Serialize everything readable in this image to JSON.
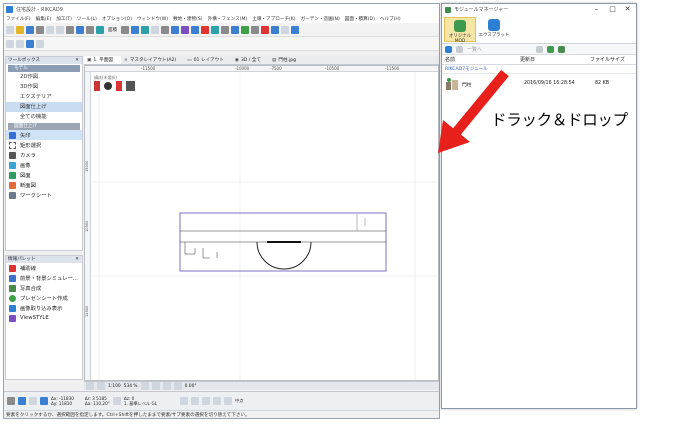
{
  "main_window": {
    "title": "住宅設計 - RIKCAD9",
    "menu": [
      "ファイル(F)",
      "編集(E)",
      "加工(T)",
      "ツール(L)",
      "オプション(O)",
      "ウィンドウ(W)",
      "敷地・建物(S)",
      "外構・フェンス(M)",
      "土壌・アプローチ(K)",
      "ガーデン・造園(N)",
      "図面・積算(D)",
      "ヘルプ(H)"
    ],
    "toolbar_label": "面積"
  },
  "tool_box": {
    "title": "ツールボックス",
    "group_top": "モデル",
    "tree_items": [
      "2D作図",
      "3D作図",
      "エクステリア",
      "図面仕上げ",
      "全ての機能"
    ],
    "selected_tree_item": "図面仕上げ",
    "group_bottom": "図面仕上げ",
    "tools": [
      "矢印",
      "矩形選択",
      "カメラ",
      "画像",
      "図面",
      "断面図",
      "ワークシート"
    ]
  },
  "model_palette": {
    "title": "情報パレット",
    "items": [
      "補助線",
      "前景・背景シミュレー...",
      "写真合成",
      "プレゼンシート作成",
      "画像取り込み表示",
      "ViewSTYLE"
    ]
  },
  "doc_tabs": [
    {
      "glyph": "▣",
      "label": "1. 平面図"
    },
    {
      "glyph": "×",
      "label": "マスタレイアウト(A2)"
    },
    {
      "glyph": "▭",
      "label": "01 レイアウト"
    },
    {
      "glyph": "◉",
      "label": "3D / 全て"
    },
    {
      "glyph": "▤",
      "label": "門柱.jpg"
    }
  ],
  "canvas": {
    "ruler_top": [
      "-11500",
      "-10000",
      "-7500",
      "-10500",
      "-11500"
    ],
    "ruler_left": [
      "15000",
      "10500",
      "12500"
    ],
    "dock_label": "構成(未選択)"
  },
  "view_bar": {
    "items": [
      "1:100",
      "534 %",
      "0.00°"
    ]
  },
  "coord_bar": {
    "x_label": "Δx: -11830",
    "y_label": "Δy: 11810",
    "r_label": "Δr: 3 5185",
    "a_label": "Δa: 110.20°",
    "z_label": "Δz: 0",
    "base_label": "1. 基準レベル GL",
    "mid_label": "中点"
  },
  "status_text": "要素をクリックするか、選択範囲を指定します。Ctrl+Shiftを押したままで要素/サブ要素の選択を切り替えて下さい。",
  "module_manager": {
    "title": "モジュールマネージャー",
    "ribbon": [
      "オリジナルMOD",
      "エクスプラット"
    ],
    "nav_label": "一覧へ",
    "columns": [
      "名前",
      "更新日",
      "ファイルサイズ"
    ],
    "path": "RIKCAD7モジュール",
    "files": [
      {
        "name": "門柱",
        "date": "2016/09/16 16:28:54",
        "size": "82 KB"
      }
    ]
  },
  "annotation": {
    "label": "ドラック＆ドロップ",
    "color": "#e8201c"
  }
}
